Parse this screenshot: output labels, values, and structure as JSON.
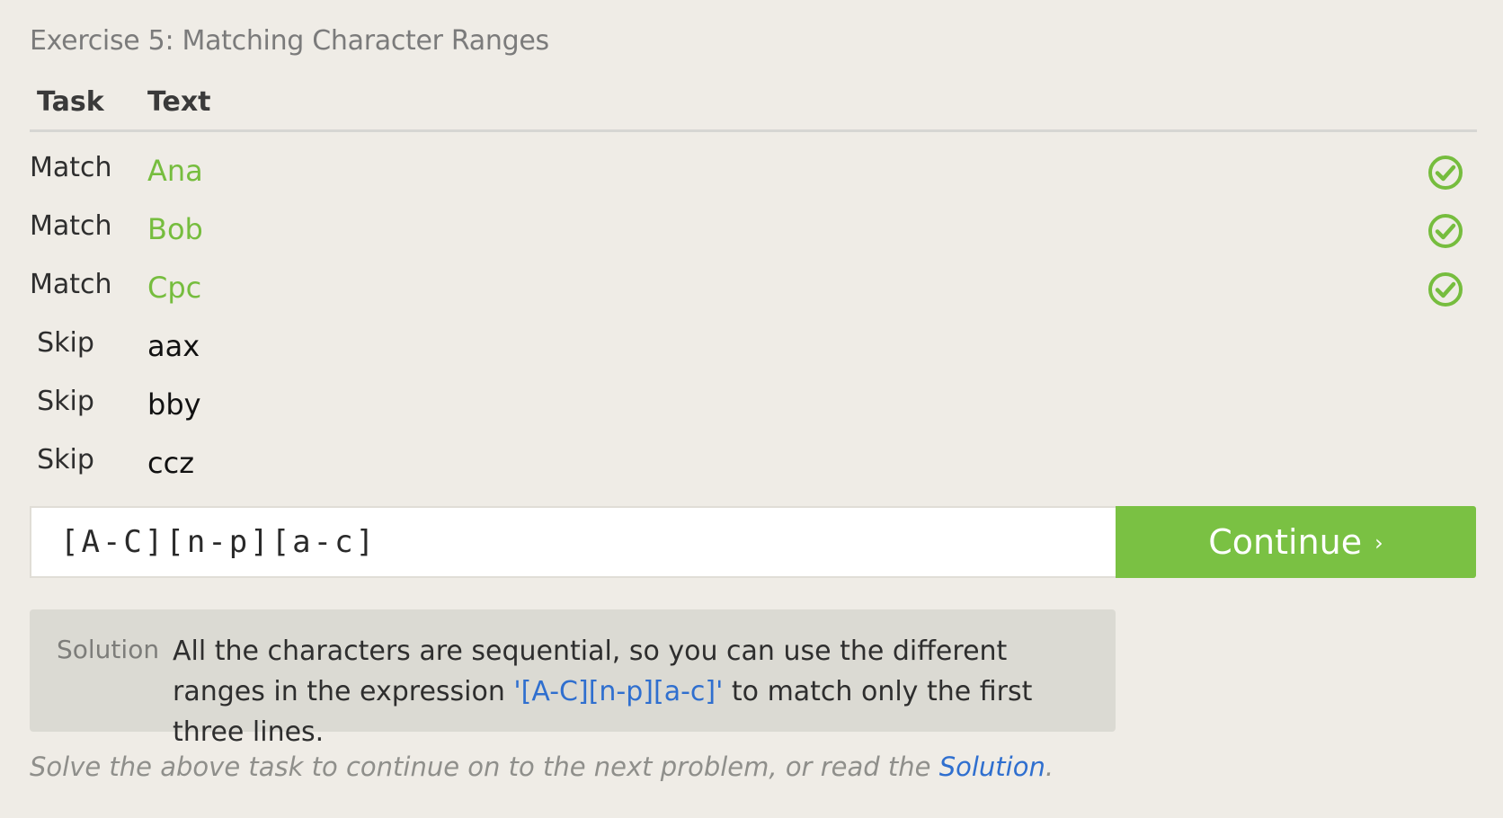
{
  "exercise": {
    "title": "Exercise 5: Matching Character Ranges"
  },
  "table": {
    "headers": {
      "task": "Task",
      "text": "Text"
    },
    "rows": [
      {
        "task": "Match",
        "text": "Ana",
        "status": "check-icon"
      },
      {
        "task": "Match",
        "text": "Bob",
        "status": "check-icon"
      },
      {
        "task": "Match",
        "text": "Cpc",
        "status": "check-icon"
      },
      {
        "task": "Skip",
        "text": "aax",
        "status": ""
      },
      {
        "task": "Skip",
        "text": "bby",
        "status": ""
      },
      {
        "task": "Skip",
        "text": "ccz",
        "status": ""
      }
    ]
  },
  "input": {
    "value": "[A-C][n-p][a-c]"
  },
  "continue_button": {
    "label": "Continue",
    "chevron": "›"
  },
  "solution": {
    "label": "Solution",
    "text_before": "All the characters are sequential, so you can use the different ranges in the expression ",
    "code": "'[A-C][n-p][a-c]'",
    "text_after": " to match only the first three lines."
  },
  "footer": {
    "text_before": "Solve the above task to continue on to the next problem, or read the ",
    "link": "Solution",
    "text_after": "."
  },
  "colors": {
    "background": "#efece6",
    "match_green": "#76bd3e",
    "button_green": "#7ac143",
    "link_blue": "#2f6fcf",
    "solution_bg": "#dbdad3"
  }
}
